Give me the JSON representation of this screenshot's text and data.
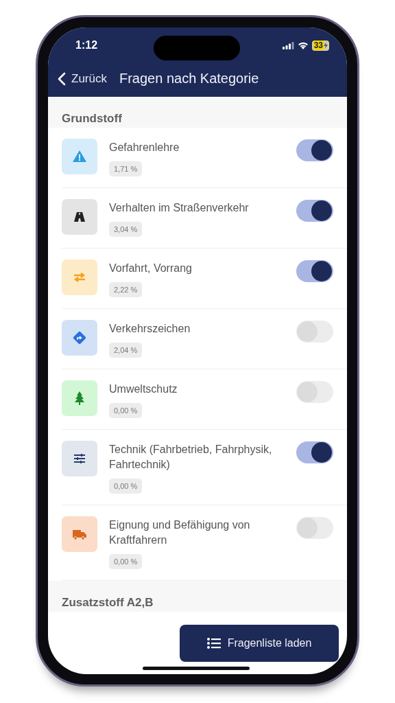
{
  "status_bar": {
    "time": "1:12",
    "battery": "33"
  },
  "nav": {
    "back": "Zurück",
    "title": "Fragen nach Kategorie"
  },
  "sections": [
    {
      "title": "Grundstoff",
      "items": [
        {
          "kind": "warning",
          "color": "#2b9be0",
          "title": "Gefahrenlehre",
          "share": "1,71 %",
          "on": true
        },
        {
          "kind": "road",
          "color": "#222222",
          "title": "Verhalten im Straßenverkehr",
          "share": "3,04 %",
          "on": true
        },
        {
          "kind": "arrows",
          "color": "#f5a21c",
          "title": "Vorfahrt, Vorrang",
          "share": "2,22 %",
          "on": true
        },
        {
          "kind": "sign",
          "color": "#2a6fdc",
          "title": "Verkehrszeichen",
          "share": "2,04 %",
          "on": false
        },
        {
          "kind": "tree",
          "color": "#1a8a2a",
          "title": "Umweltschutz",
          "share": "0,00 %",
          "on": false
        },
        {
          "kind": "sliders",
          "color": "#2b3a6a",
          "title": "Technik (Fahrbetrieb, Fahrphysik, Fahrtechnik)",
          "share": "0,00 %",
          "on": true
        },
        {
          "kind": "truck",
          "color": "#d8661e",
          "title": "Eignung und Befähigung von Kraftfahrern",
          "share": "0,00 %",
          "on": false
        }
      ]
    },
    {
      "title": "Zusatzstoff A2,B"
    }
  ],
  "action_button": {
    "label": "Fragenliste laden"
  }
}
